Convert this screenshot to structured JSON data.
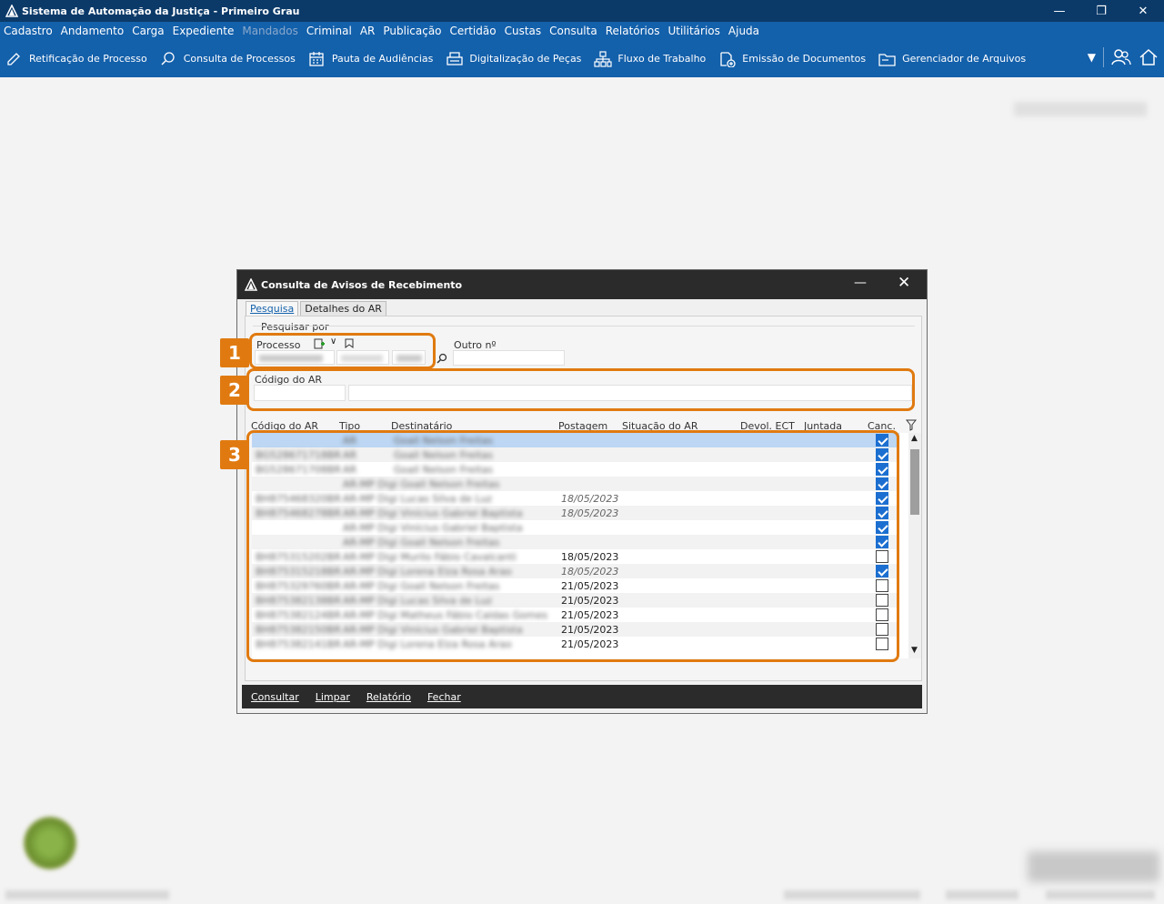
{
  "app": {
    "title": "Sistema de Automação da Justiça - Primeiro Grau"
  },
  "menu": [
    {
      "label": "Cadastro",
      "enabled": true
    },
    {
      "label": "Andamento",
      "enabled": true
    },
    {
      "label": "Carga",
      "enabled": true
    },
    {
      "label": "Expediente",
      "enabled": true
    },
    {
      "label": "Mandados",
      "enabled": false
    },
    {
      "label": "Criminal",
      "enabled": true
    },
    {
      "label": "AR",
      "enabled": true
    },
    {
      "label": "Publicação",
      "enabled": true
    },
    {
      "label": "Certidão",
      "enabled": true
    },
    {
      "label": "Custas",
      "enabled": true
    },
    {
      "label": "Consulta",
      "enabled": true
    },
    {
      "label": "Relatórios",
      "enabled": true
    },
    {
      "label": "Utilitários",
      "enabled": true
    },
    {
      "label": "Ajuda",
      "enabled": true
    }
  ],
  "toolbar": [
    {
      "label": "Retificação de Processo",
      "icon": "pencil-icon"
    },
    {
      "label": "Consulta de Processos",
      "icon": "search-icon"
    },
    {
      "label": "Pauta de Audiências",
      "icon": "calendar-icon"
    },
    {
      "label": "Digitalização de Peças",
      "icon": "scanner-icon"
    },
    {
      "label": "Fluxo de Trabalho",
      "icon": "workflow-icon"
    },
    {
      "label": "Emissão de Documentos",
      "icon": "document-add-icon"
    },
    {
      "label": "Gerenciador de Arquivos",
      "icon": "folder-icon"
    }
  ],
  "dialog": {
    "title": "Consulta de Avisos de Recebimento",
    "tabs": [
      "Pesquisa",
      "Detalhes do AR"
    ],
    "section_label": "Pesquisar por",
    "processo_label": "Processo",
    "outro_label": "Outro nº",
    "codigo_label": "Código do AR",
    "columns": [
      "Código do AR",
      "Tipo",
      "Destinatário",
      "Postagem",
      "Situação do AR",
      "Devol. ECT",
      "Juntada",
      "Canc."
    ],
    "rows": [
      {
        "codigo": "",
        "tipo": "AR",
        "destinatario": "Goall Nelson Freitas",
        "postagem": "",
        "checked": true,
        "italic": false,
        "sel": true
      },
      {
        "codigo": "BG528671718BR",
        "tipo": "AR",
        "destinatario": "Goall Nelson Freitas",
        "postagem": "",
        "checked": true,
        "italic": false,
        "sel": false
      },
      {
        "codigo": "BG528671708BR",
        "tipo": "AR",
        "destinatario": "Goall Nelson Freitas",
        "postagem": "",
        "checked": true,
        "italic": false,
        "sel": false
      },
      {
        "codigo": "",
        "tipo": "AR-MP Digi Goall Nelson Freitas",
        "destinatario": "",
        "postagem": "",
        "checked": true,
        "italic": false,
        "sel": false
      },
      {
        "codigo": "BH875468320BR",
        "tipo": "AR-MP Digi Lucas Silva de Luz",
        "destinatario": "",
        "postagem": "18/05/2023",
        "checked": true,
        "italic": true,
        "sel": false
      },
      {
        "codigo": "BH875468278BR",
        "tipo": "AR-MP Digi Vinícius Gabriel Baptista",
        "destinatario": "",
        "postagem": "18/05/2023",
        "checked": true,
        "italic": true,
        "sel": false
      },
      {
        "codigo": "",
        "tipo": "AR-MP Digi Vinícius Gabriel Baptista",
        "destinatario": "",
        "postagem": "",
        "checked": true,
        "italic": false,
        "sel": false
      },
      {
        "codigo": "",
        "tipo": "AR-MP Digi Goall Nelson Freitas",
        "destinatario": "",
        "postagem": "",
        "checked": true,
        "italic": false,
        "sel": false
      },
      {
        "codigo": "BH875315202BR",
        "tipo": "AR-MP Digi Murilo Fábio Cavalcanti",
        "destinatario": "",
        "postagem": "18/05/2023",
        "checked": false,
        "italic": false,
        "sel": false
      },
      {
        "codigo": "BH875315218BR",
        "tipo": "AR-MP Digi Lorena Elza Rosa Arao",
        "destinatario": "",
        "postagem": "18/05/2023",
        "checked": true,
        "italic": true,
        "sel": false
      },
      {
        "codigo": "BH875329760BR",
        "tipo": "AR-MP Digi Goall Nelson Freitas",
        "destinatario": "",
        "postagem": "21/05/2023",
        "checked": false,
        "italic": false,
        "sel": false
      },
      {
        "codigo": "BH875382138BR",
        "tipo": "AR-MP Digi Lucas Silva de Luz",
        "destinatario": "",
        "postagem": "21/05/2023",
        "checked": false,
        "italic": false,
        "sel": false
      },
      {
        "codigo": "BH875382124BR",
        "tipo": "AR-MP Digi Matheus Fábio Caldas Gomes",
        "destinatario": "",
        "postagem": "21/05/2023",
        "checked": false,
        "italic": false,
        "sel": false
      },
      {
        "codigo": "BH875382150BR",
        "tipo": "AR-MP Digi Vinícius Gabriel Baptista",
        "destinatario": "",
        "postagem": "21/05/2023",
        "checked": false,
        "italic": false,
        "sel": false
      },
      {
        "codigo": "BH875382141BR",
        "tipo": "AR-MP Digi Lorena Elza Rosa Arao",
        "destinatario": "",
        "postagem": "21/05/2023",
        "checked": false,
        "italic": false,
        "sel": false
      }
    ],
    "buttons": [
      "Consultar",
      "Limpar",
      "Relatório",
      "Fechar"
    ]
  },
  "callouts": [
    "1",
    "2",
    "3"
  ],
  "colors": {
    "accent": "#1360ab",
    "titlebar": "#0b3a69",
    "callout": "#e07a10"
  }
}
